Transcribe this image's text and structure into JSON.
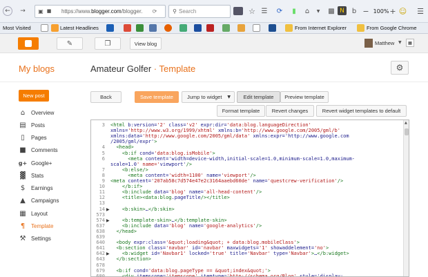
{
  "browser": {
    "url_prefix": "https://www.",
    "url_domain": "blogger.com",
    "url_suffix": "/blogger.",
    "search_placeholder": "Search",
    "zoom": "100%"
  },
  "bookmarks": [
    {
      "label": "Most Visited"
    },
    {
      "label": "Latest Headlines"
    },
    {
      "label": "From Internet Explorer"
    },
    {
      "label": "From Google Chrome"
    }
  ],
  "blogger": {
    "view_blog": "View blog",
    "user": "Matthew"
  },
  "page": {
    "my_blogs": "My blogs",
    "blog_name": "Amateur Golfer",
    "separator": "·",
    "section": "Template"
  },
  "sidebar": {
    "new_post": "New post",
    "items": [
      {
        "label": "Overview",
        "icon": "home-icon"
      },
      {
        "label": "Posts",
        "icon": "posts-icon"
      },
      {
        "label": "Pages",
        "icon": "pages-icon"
      },
      {
        "label": "Comments",
        "icon": "comments-icon"
      },
      {
        "label": "Google+",
        "icon": "google-plus-icon"
      },
      {
        "label": "Stats",
        "icon": "stats-icon"
      },
      {
        "label": "Earnings",
        "icon": "earnings-icon"
      },
      {
        "label": "Campaigns",
        "icon": "campaigns-icon"
      },
      {
        "label": "Layout",
        "icon": "layout-icon"
      },
      {
        "label": "Template",
        "icon": "template-icon"
      },
      {
        "label": "Settings",
        "icon": "settings-icon"
      }
    ]
  },
  "toolbar": {
    "back": "Back",
    "save": "Save template",
    "jump": "Jump to widget",
    "edit": "Edit template",
    "preview": "Preview template",
    "format": "Format template",
    "revert": "Revert changes",
    "revert_widgets": "Revert widget templates to default"
  },
  "code_lines": [
    {
      "n": "3",
      "t": "<html b:version='2' class='v2' expr:dir='data:blog.languageDirection'"
    },
    {
      "n": "",
      "t": "xmlns='http://www.w3.org/1999/xhtml' xmlns:b='http://www.google.com/2005/gml/b'"
    },
    {
      "n": "",
      "t": "xmlns:data='http://www.google.com/2005/gml/data' xmlns:expr='http://www.google.com"
    },
    {
      "n": "",
      "t": "/2005/gml/expr'>"
    },
    {
      "n": "4",
      "t": "  <head>"
    },
    {
      "n": "5",
      "t": "    <b:if cond='data:blog.isMobile'>"
    },
    {
      "n": "6",
      "t": "      <meta content='width=device-width,initial-scale=1.0,minimum-scale=1.0,maximum-"
    },
    {
      "n": "",
      "t": "scale=1.0' name='viewport'/>"
    },
    {
      "n": "7",
      "t": "    <b:else/>"
    },
    {
      "n": "8",
      "t": "      <meta content='width=1100' name='viewport'/>"
    },
    {
      "n": "9",
      "t": "<meta content='207ab58c7d574e47e2c3164aaebd60de' name='questcrew-verification'/>"
    },
    {
      "n": "10",
      "t": "    </b:if>"
    },
    {
      "n": "11",
      "t": "    <b:include data='blog' name='all-head-content'/>"
    },
    {
      "n": "12",
      "t": "    <title><data:blog.pageTitle/></title>"
    },
    {
      "n": "13",
      "t": ""
    },
    {
      "n": "14",
      "t": "    <b:skin>…</b:skin>"
    },
    {
      "n": "573",
      "t": ""
    },
    {
      "n": "574",
      "t": "    <b:template-skin>…</b:template-skin>"
    },
    {
      "n": "637",
      "t": "    <b:include data='blog' name='google-analytics'/>"
    },
    {
      "n": "638",
      "t": "  </head>"
    },
    {
      "n": "639",
      "t": ""
    },
    {
      "n": "640",
      "t": "  <body expr:class='&quot;loading&quot; + data:blog.mobileClass'>"
    },
    {
      "n": "641",
      "t": "  <b:section class='navbar' id='navbar' maxwidgets='1' showaddelement='no'>"
    },
    {
      "n": "642",
      "t": "    <b:widget id='Navbar1' locked='true' title='Navbar' type='Navbar'>…</b:widget>"
    },
    {
      "n": "643",
      "t": "  </b:section>"
    },
    {
      "n": "678",
      "t": ""
    },
    {
      "n": "679",
      "t": "  <b:if cond='data:blog.pageType == &quot;index&quot;'>"
    },
    {
      "n": "680",
      "t": "    <div itemscope='itemscope' itemtype='http://schema.org/Blog' style='display:"
    }
  ]
}
